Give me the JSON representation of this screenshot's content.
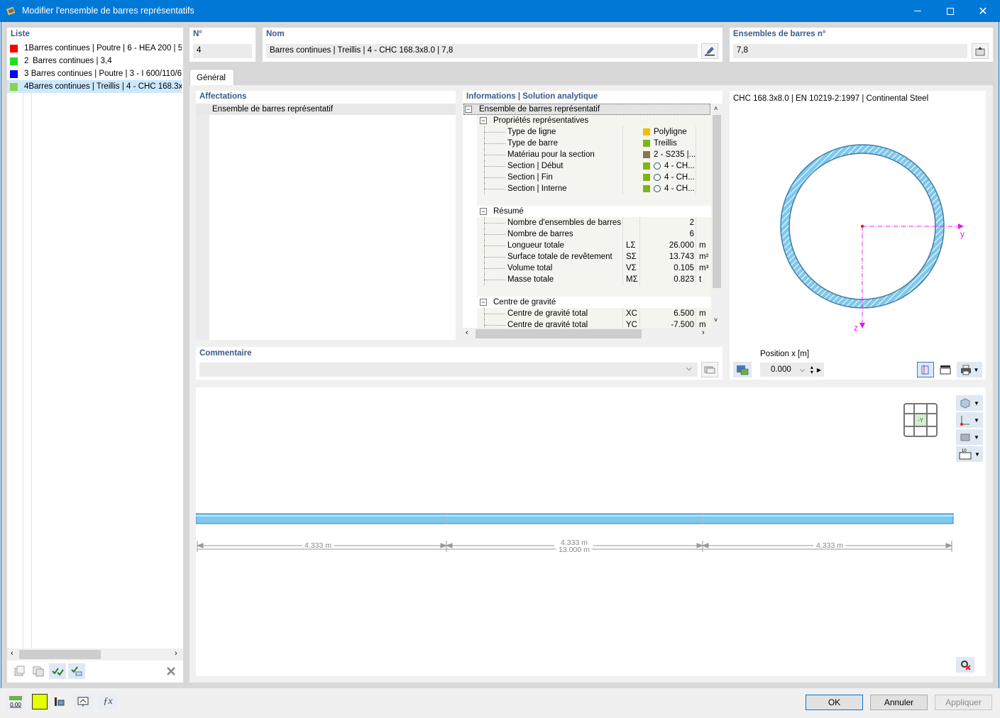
{
  "window": {
    "title": "Modifier l'ensemble de barres représentatifs"
  },
  "list": {
    "header": "Liste",
    "items": [
      {
        "num": "1",
        "label": "Barres continues | Poutre | 6 - HEA 200 | 5",
        "color": "#ff0000"
      },
      {
        "num": "2",
        "label": "Barres continues | 3,4",
        "color": "#22dd22"
      },
      {
        "num": "3",
        "label": "Barres continues | Poutre | 3 - I 600/110/6",
        "color": "#0000ff"
      },
      {
        "num": "4",
        "label": "Barres continues | Treillis | 4 - CHC 168.3x",
        "color": "#8cd24a"
      }
    ]
  },
  "no": {
    "label": "N°",
    "value": "4"
  },
  "name": {
    "label": "Nom",
    "value": "Barres continues | Treillis | 4 - CHC 168.3x8.0 | 7,8"
  },
  "sets": {
    "label": "Ensembles de barres n°",
    "value": "7,8"
  },
  "tabs": {
    "general": "Général"
  },
  "affect": {
    "header": "Affectations",
    "item": "Ensemble de barres représentatif"
  },
  "info": {
    "header": "Informations | Solution analytique",
    "root": "Ensemble de barres représentatif",
    "group1": "Propriétés représentatives",
    "props": [
      {
        "label": "Type de ligne",
        "value": "Polyligne",
        "color": "#f0c000"
      },
      {
        "label": "Type de barre",
        "value": "Treillis",
        "color": "#7cb518"
      },
      {
        "label": "Matériau pour la section",
        "value": "2 - S235 |...",
        "color": "#8b7355"
      },
      {
        "label": "Section | Début",
        "value": "4 - CH...",
        "color": "#7cb518"
      },
      {
        "label": "Section | Fin",
        "value": "4 - CH...",
        "color": "#7cb518"
      },
      {
        "label": "Section | Interne",
        "value": "4 - CH...",
        "color": "#7cb518"
      }
    ],
    "group2": "Résumé",
    "summary": [
      {
        "label": "Nombre d'ensembles de barres",
        "sym": "",
        "val": "2",
        "unit": ""
      },
      {
        "label": "Nombre de barres",
        "sym": "",
        "val": "6",
        "unit": ""
      },
      {
        "label": "Longueur totale",
        "sym": "LΣ",
        "val": "26.000",
        "unit": "m"
      },
      {
        "label": "Surface totale de revêtement",
        "sym": "SΣ",
        "val": "13.743",
        "unit": "m²"
      },
      {
        "label": "Volume total",
        "sym": "VΣ",
        "val": "0.105",
        "unit": "m³"
      },
      {
        "label": "Masse totale",
        "sym": "MΣ",
        "val": "0.823",
        "unit": "t"
      }
    ],
    "group3": "Centre de gravité",
    "cog": [
      {
        "label": "Centre de gravité total",
        "sym": "XC",
        "val": "6.500",
        "unit": "m"
      },
      {
        "label": "Centre de gravité total",
        "sym": "YC",
        "val": "-7.500",
        "unit": "m"
      }
    ]
  },
  "section": {
    "title": "CHC 168.3x8.0 | EN 10219-2:1997 | Continental Steel",
    "axis_y": "y",
    "axis_z": "z",
    "position_label": "Position x [m]",
    "position_value": "0.000"
  },
  "comment": {
    "label": "Commentaire",
    "value": ""
  },
  "view": {
    "seg1": "4.333 m",
    "seg2": "4.333 m",
    "seg3": "4.333 m",
    "total": "13.000 m",
    "axis_tag": "-Y",
    "scale_tag": "10"
  },
  "buttons": {
    "ok": "OK",
    "cancel": "Annuler",
    "apply": "Appliquer"
  },
  "footer": {
    "zero": "0.00"
  }
}
